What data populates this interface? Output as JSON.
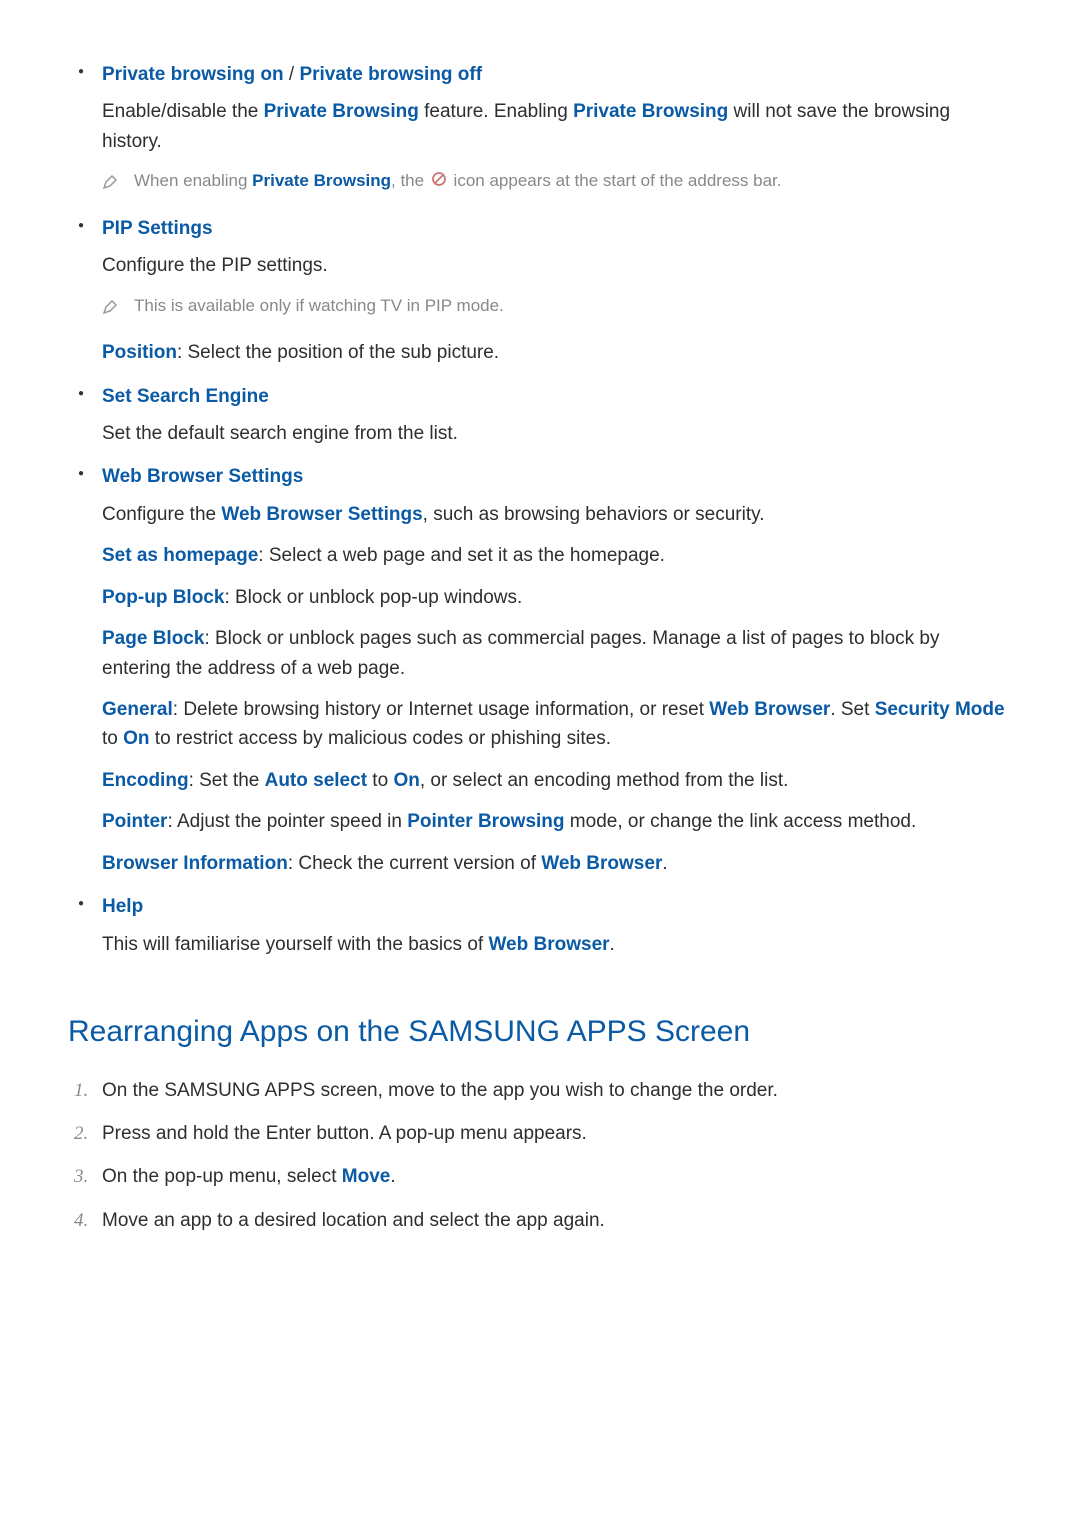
{
  "items": {
    "privateBrowsing": {
      "titleOn": "Private browsing on",
      "sep": " / ",
      "titleOff": "Private browsing off",
      "p1_a": "Enable/disable the ",
      "p1_b": "Private Browsing",
      "p1_c": " feature. Enabling ",
      "p1_d": "Private Browsing",
      "p1_e": " will not save the browsing history.",
      "note_a": "When enabling ",
      "note_b": "Private Browsing",
      "note_c": ", the ",
      "note_d": " icon appears at the start of the address bar."
    },
    "pip": {
      "title": "PIP Settings",
      "p1": "Configure the PIP settings.",
      "note": "This is available only if watching TV in PIP mode.",
      "pos_label": "Position",
      "pos_desc": ": Select the position of the sub picture."
    },
    "searchEngine": {
      "title": "Set Search Engine",
      "p1": "Set the default search engine from the list."
    },
    "webBrowser": {
      "title": "Web Browser Settings",
      "p1_a": "Configure the ",
      "p1_b": "Web Browser Settings",
      "p1_c": ", such as browsing behaviors or security.",
      "home_label": "Set as homepage",
      "home_desc": ": Select a web page and set it as the homepage.",
      "popup_label": "Pop-up Block",
      "popup_desc": ": Block or unblock pop-up windows.",
      "page_label": "Page Block",
      "page_desc": ": Block or unblock pages such as commercial pages. Manage a list of pages to block by entering the address of a web page.",
      "general_label": "General",
      "general_a": ": Delete browsing history or Internet usage information, or reset ",
      "general_b": "Web Browser",
      "general_c": ". Set ",
      "general_d": "Security Mode",
      "general_e": " to ",
      "general_f": "On",
      "general_g": " to restrict access by malicious codes or phishing sites.",
      "encoding_label": "Encoding",
      "encoding_a": ": Set the ",
      "encoding_b": "Auto select",
      "encoding_c": " to ",
      "encoding_d": "On",
      "encoding_e": ", or select an encoding method from the list.",
      "pointer_label": "Pointer",
      "pointer_a": ": Adjust the pointer speed in ",
      "pointer_b": "Pointer Browsing",
      "pointer_c": " mode, or change the link access method.",
      "info_label": "Browser Information",
      "info_a": ": Check the current version of ",
      "info_b": "Web Browser",
      "info_c": "."
    },
    "help": {
      "title": "Help",
      "p1_a": "This will familiarise yourself with the basics of ",
      "p1_b": "Web Browser",
      "p1_c": "."
    }
  },
  "section2": {
    "heading": "Rearranging Apps on the SAMSUNG APPS Screen",
    "steps": {
      "s1": "On the SAMSUNG APPS screen, move to the app you wish to change the order.",
      "s2": "Press and hold the Enter button. A pop-up menu appears.",
      "s3_a": "On the pop-up menu, select ",
      "s3_b": "Move",
      "s3_c": ".",
      "s4": "Move an app to a desired location and select the app again."
    }
  }
}
